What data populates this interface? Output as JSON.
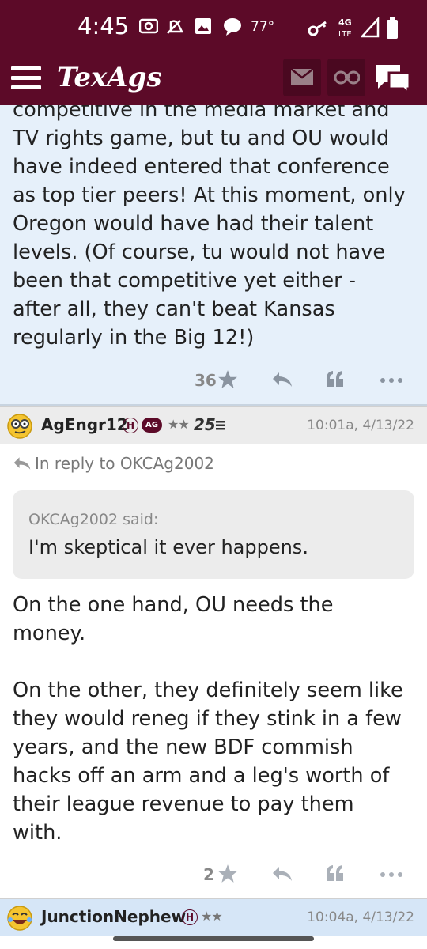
{
  "status_bar": {
    "time": "4:45",
    "temperature": "77°",
    "network": "4G LTE"
  },
  "app": {
    "logo": "TexAgs"
  },
  "post1": {
    "text": "competitive in the media market and\nTV rights game, but tu and OU would\nhave indeed entered that conference\nas top tier peers! At this moment, only\nOregon would have had their talent\nlevels. (Of course, tu would not have\nbeen that competitive yet either -\nafter all, they can't beat Kansas\nregularly in the Big 12!)",
    "star_count": "36"
  },
  "post2": {
    "username": "AgEngr12",
    "h_badge": "H",
    "ag_badge": "AG",
    "stars": "★★",
    "level": "25",
    "timestamp": "10:01a, 4/13/22",
    "reply_to": "In reply to OKCAg2002",
    "quote_author": "OKCAg2002 said:",
    "quote_text": "I'm skeptical it ever happens.",
    "text": "On the one hand, OU needs the\nmoney.\n\nOn the other, they definitely seem like\nthey would reneg if they stink in a few\nyears, and the new BDF commish\nhacks off an arm and a leg's worth of\ntheir league revenue to pay them\nwith.",
    "star_count": "2"
  },
  "post3": {
    "username": "JunctionNephew",
    "h_badge": "H",
    "stars": "★★",
    "timestamp": "10:04a, 4/13/22"
  },
  "colors": {
    "maroon": "#5c0a28",
    "post_bg": "#e6f0fa",
    "header_grey": "#ececec",
    "header_blue": "#d6e6f7"
  }
}
